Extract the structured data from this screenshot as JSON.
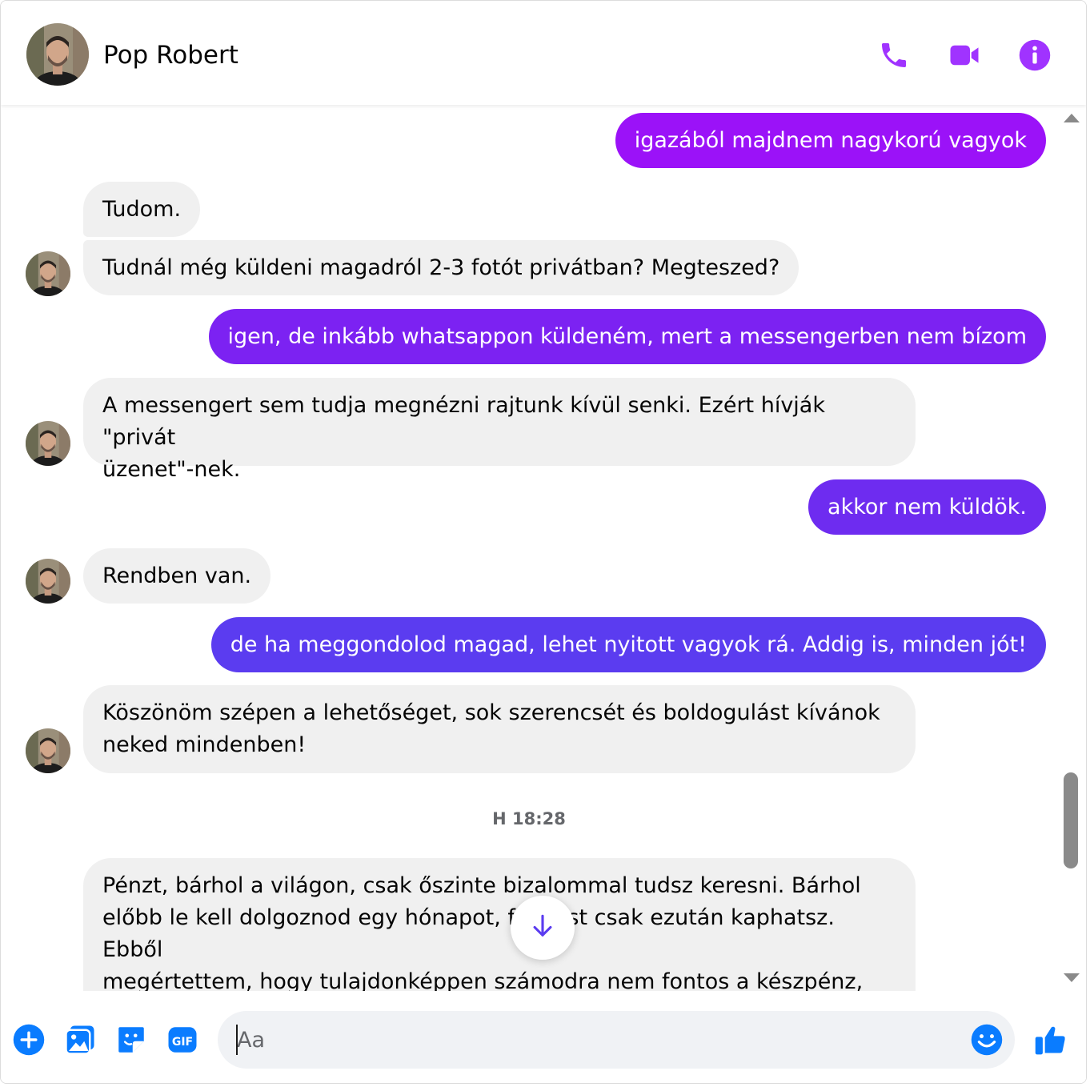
{
  "header": {
    "contact_name": "Pop Robert",
    "icons": [
      "phone-icon",
      "video-camera-icon",
      "info-icon"
    ],
    "accent_color": "#a033ff"
  },
  "messages": [
    {
      "direction": "out",
      "text": "igazából majdnem nagykorú vagyok",
      "color": "#9b12f8"
    },
    {
      "direction": "in",
      "text": "Tudom.",
      "avatar": false
    },
    {
      "direction": "in",
      "text": "Tudnál még küldeni magadról 2-3 fotót privátban? Megteszed?",
      "avatar": true
    },
    {
      "direction": "out",
      "text": "igen, de inkább whatsappon küldeném, mert a messengerben nem bízom",
      "color": "#7c22f2"
    },
    {
      "direction": "in",
      "text": "A messengert sem tudja megnézni rajtunk kívül senki. Ezért hívják \"privát\nüzenet\"-nek.",
      "avatar": true
    },
    {
      "direction": "out",
      "text": "akkor nem küldök.",
      "color": "#6e2cf0"
    },
    {
      "direction": "in",
      "text": "Rendben van.",
      "avatar": true
    },
    {
      "direction": "out",
      "text": "de ha meggondolod magad, lehet nyitott vagyok rá. Addig is, minden jót!",
      "color": "#5b3cf0"
    },
    {
      "direction": "in",
      "text": "Köszönöm szépen a lehetőséget, sok szerencsét és boldogulást kívánok\nneked mindenben!",
      "avatar": true
    },
    {
      "direction": "timestamp",
      "text": "H 18:28"
    },
    {
      "direction": "in",
      "text": "Pénzt, bárhol a világon, csak őszinte bizalommal tudsz keresni. Bárhol\nelőbb le kell dolgoznod egy hónapot, fizetést csak ezután kaphatsz. Ebből\nmegértettem, hogy tulajdonképpen számodra nem fontos a készpénz,\nnincs is olyan nagy szükséged rá. Én valóban kész lettem volna arra, hogy",
      "avatar": false
    }
  ],
  "composer": {
    "placeholder": "Aa",
    "value": "",
    "icons": [
      "plus-circle-icon",
      "image-icon",
      "sticker-icon",
      "gif-icon",
      "emoji-icon",
      "thumbs-up-icon"
    ],
    "gif_label": "GIF",
    "icon_color": "#0a7cff"
  },
  "scroll_down_icon": "arrow-down-icon"
}
